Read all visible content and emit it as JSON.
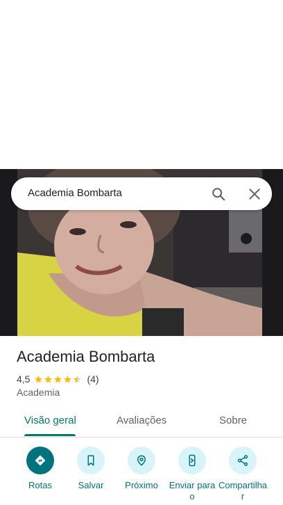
{
  "search": {
    "query": "Academia Bombarta"
  },
  "place": {
    "title": "Academia Bombarta",
    "rating": "4,5",
    "stars": 4.5,
    "reviews": "(4)",
    "category": "Academia"
  },
  "tabs": [
    {
      "label": "Visão geral",
      "active": true
    },
    {
      "label": "Avaliações",
      "active": false
    },
    {
      "label": "Sobre",
      "active": false
    }
  ],
  "actions": [
    {
      "label": "Rotas",
      "icon": "directions-icon"
    },
    {
      "label": "Salvar",
      "icon": "bookmark-icon"
    },
    {
      "label": "Próximo",
      "icon": "nearby-icon"
    },
    {
      "label": "Enviar para o",
      "icon": "send-to-phone-icon"
    },
    {
      "label": "Compartilhar",
      "icon": "share-icon"
    }
  ],
  "colors": {
    "accent": "#00796b",
    "action_primary": "#00737c",
    "action_bg": "#d7f4f8",
    "star": "#fbbc04"
  }
}
